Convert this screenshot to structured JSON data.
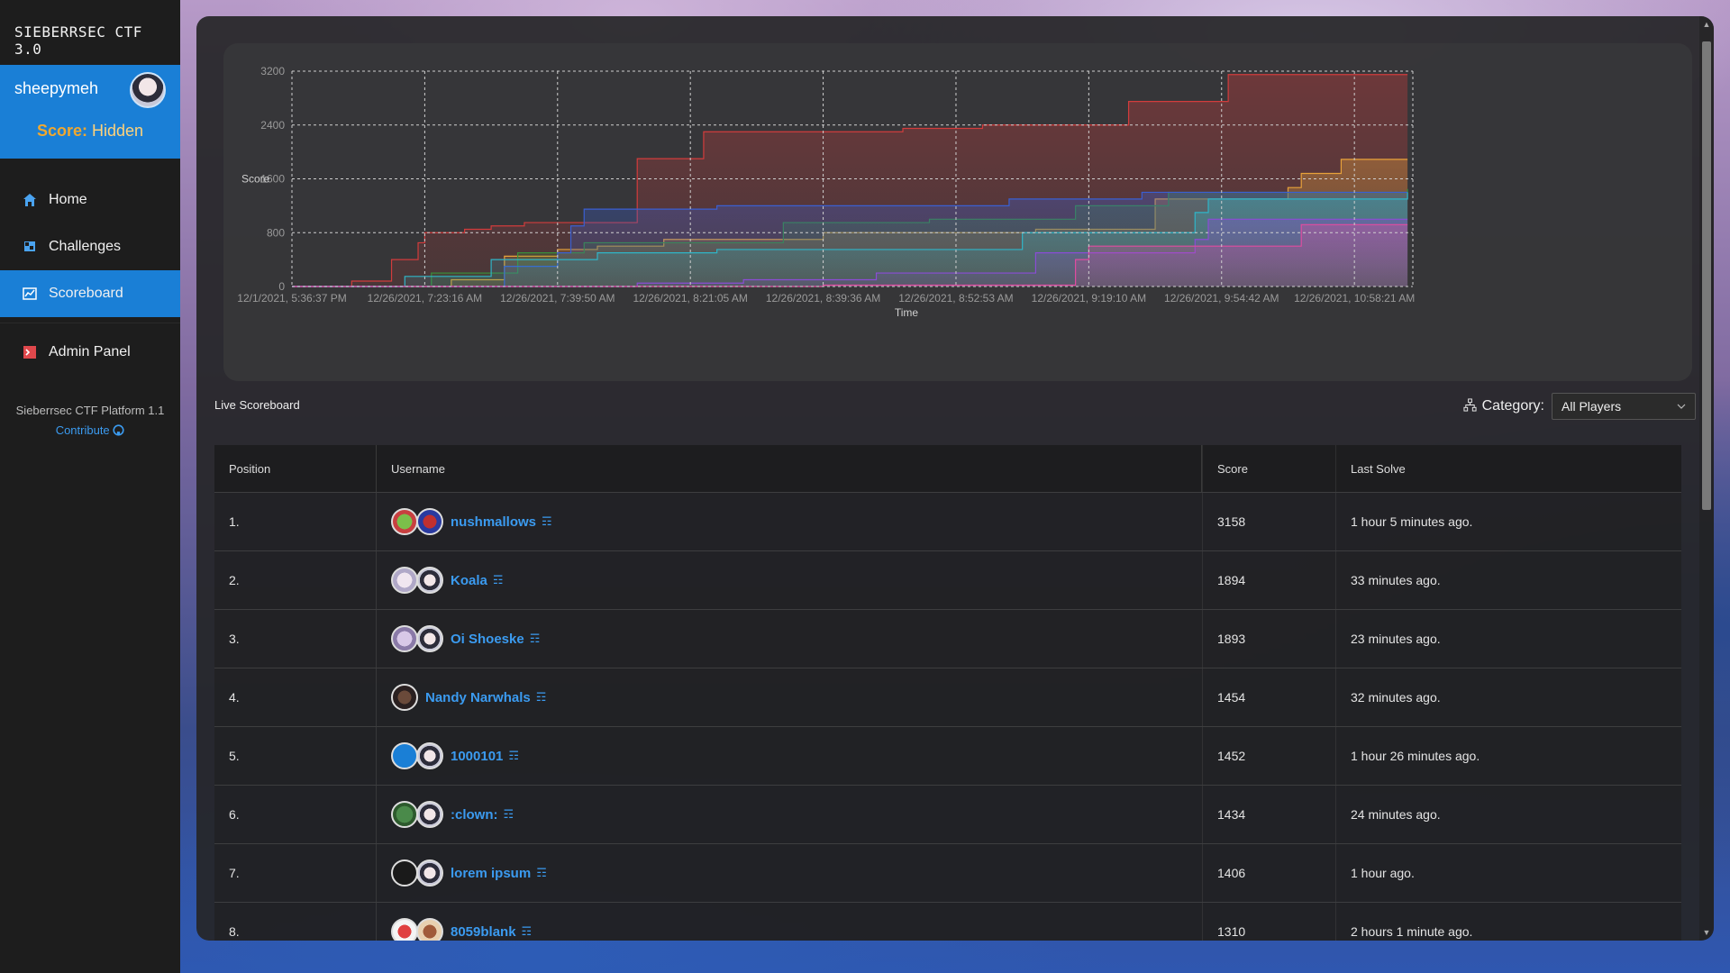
{
  "app": {
    "brand": "SIEBERRSEC CTF 3.0"
  },
  "user": {
    "name": "sheepymeh",
    "score_label": "Score:",
    "score_value": "Hidden"
  },
  "nav": [
    {
      "label": "Home",
      "icon": "home-icon"
    },
    {
      "label": "Challenges",
      "icon": "flag-icon"
    },
    {
      "label": "Scoreboard",
      "icon": "chart-icon"
    },
    {
      "label": "Admin Panel",
      "icon": "terminal-icon"
    }
  ],
  "platform": {
    "name": "Sieberrsec CTF Platform 1.1",
    "contribute": "Contribute"
  },
  "scoreboard": {
    "live_label": "Live Scoreboard",
    "category_label": "Category:",
    "category_value": "All Players",
    "headers": {
      "position": "Position",
      "username": "Username",
      "score": "Score",
      "last_solve": "Last Solve"
    },
    "rows": [
      {
        "pos": "1.",
        "name": "nushmallows",
        "score": "3158",
        "last": "1 hour 5 minutes ago."
      },
      {
        "pos": "2.",
        "name": "Koala",
        "score": "1894",
        "last": "33 minutes ago."
      },
      {
        "pos": "3.",
        "name": "Oi Shoeske",
        "score": "1893",
        "last": "23 minutes ago."
      },
      {
        "pos": "4.",
        "name": "Nandy Narwhals",
        "score": "1454",
        "last": "32 minutes ago."
      },
      {
        "pos": "5.",
        "name": "1000101",
        "score": "1452",
        "last": "1 hour 26 minutes ago."
      },
      {
        "pos": "6.",
        "name": ":clown:",
        "score": "1434",
        "last": "24 minutes ago."
      },
      {
        "pos": "7.",
        "name": "lorem ipsum",
        "score": "1406",
        "last": "1 hour ago."
      },
      {
        "pos": "8.",
        "name": "8059blank",
        "score": "1310",
        "last": "2 hours 1 minute ago."
      }
    ]
  },
  "chart_data": {
    "type": "area",
    "xlabel": "Time",
    "ylabel": "Score",
    "ylim": [
      0,
      3200
    ],
    "yticks": [
      "0",
      "800",
      "1600",
      "2400",
      "3200"
    ],
    "xticks": [
      "12/1/2021, 5:36:37 PM",
      "12/26/2021, 7:23:16 AM",
      "12/26/2021, 7:39:50 AM",
      "12/26/2021, 8:21:05 AM",
      "12/26/2021, 8:39:36 AM",
      "12/26/2021, 8:52:53 AM",
      "12/26/2021, 9:19:10 AM",
      "12/26/2021, 9:54:42 AM",
      "12/26/2021, 10:58:21 AM"
    ],
    "grid": true,
    "series": [
      {
        "color": "#d23c3c",
        "values": [
          [
            0,
            0
          ],
          [
            0.45,
            80
          ],
          [
            0.75,
            400
          ],
          [
            0.95,
            650
          ],
          [
            1.0,
            800
          ],
          [
            1.3,
            850
          ],
          [
            1.5,
            900
          ],
          [
            1.75,
            950
          ],
          [
            2.2,
            950
          ],
          [
            2.6,
            1900
          ],
          [
            3.1,
            1900
          ],
          [
            3.1,
            2300
          ],
          [
            4.0,
            2300
          ],
          [
            4.6,
            2350
          ],
          [
            5.2,
            2400
          ],
          [
            6.2,
            2400
          ],
          [
            6.3,
            2750
          ],
          [
            7.0,
            2750
          ],
          [
            7.05,
            3150
          ],
          [
            8.4,
            3150
          ]
        ]
      },
      {
        "color": "#e8a23a",
        "values": [
          [
            0,
            0
          ],
          [
            1.2,
            100
          ],
          [
            1.6,
            450
          ],
          [
            2.0,
            550
          ],
          [
            2.3,
            600
          ],
          [
            2.8,
            700
          ],
          [
            4.0,
            800
          ],
          [
            5.6,
            850
          ],
          [
            6.5,
            1300
          ],
          [
            7.4,
            1300
          ],
          [
            7.5,
            1470
          ],
          [
            7.6,
            1680
          ],
          [
            7.9,
            1890
          ],
          [
            8.4,
            1890
          ]
        ]
      },
      {
        "color": "#3a8f3a",
        "values": [
          [
            0,
            0
          ],
          [
            1.05,
            200
          ],
          [
            1.7,
            500
          ],
          [
            2.2,
            650
          ],
          [
            3.7,
            950
          ],
          [
            4.8,
            1000
          ],
          [
            5.9,
            1200
          ],
          [
            6.6,
            1400
          ],
          [
            8.4,
            1450
          ]
        ]
      },
      {
        "color": "#3a5fd2",
        "values": [
          [
            0,
            0
          ],
          [
            1.6,
            300
          ],
          [
            2.0,
            500
          ],
          [
            2.1,
            900
          ],
          [
            2.2,
            1150
          ],
          [
            3.2,
            1200
          ],
          [
            5.4,
            1300
          ],
          [
            6.4,
            1400
          ],
          [
            8.4,
            1400
          ]
        ]
      },
      {
        "color": "#2fb5c8",
        "values": [
          [
            0,
            0
          ],
          [
            0.85,
            150
          ],
          [
            1.5,
            400
          ],
          [
            2.3,
            500
          ],
          [
            3.2,
            550
          ],
          [
            5.5,
            800
          ],
          [
            6.8,
            1100
          ],
          [
            6.9,
            1300
          ],
          [
            8.4,
            1400
          ]
        ]
      },
      {
        "color": "#8a4cd6",
        "values": [
          [
            0,
            0
          ],
          [
            2.6,
            50
          ],
          [
            3.4,
            100
          ],
          [
            4.4,
            200
          ],
          [
            5.6,
            500
          ],
          [
            6.8,
            700
          ],
          [
            6.9,
            1000
          ],
          [
            8.4,
            1000
          ]
        ]
      },
      {
        "color": "#e04ca0",
        "values": [
          [
            0,
            0
          ],
          [
            4.0,
            20
          ],
          [
            5.9,
            400
          ],
          [
            6.0,
            600
          ],
          [
            7.5,
            600
          ],
          [
            7.6,
            920
          ],
          [
            8.4,
            920
          ]
        ]
      }
    ]
  }
}
